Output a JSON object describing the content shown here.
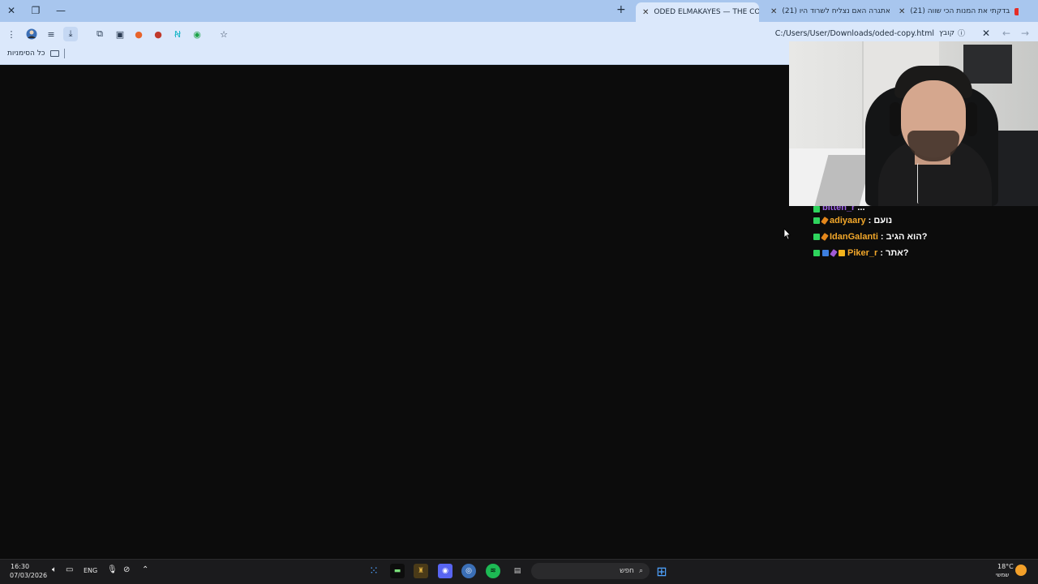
{
  "tabs": [
    {
      "title": "(21) בדקתי את המנות הכי שווה",
      "active": false
    },
    {
      "title": "(21) אתגרה האם נצליח לשרוד היו",
      "active": false
    },
    {
      "title": "ODED ELMAKAYES — THE COPY",
      "active": true
    }
  ],
  "address": {
    "url": "C:/Users/User/Downloads/oded-copy.html",
    "file_chip": "קובץ"
  },
  "bookmarks": {
    "all_bookmarks": "כל הסימניות"
  },
  "chat": {
    "partial_row": {
      "username": "bitten_r",
      "message": "..."
    },
    "rows": [
      {
        "username": "adiyaary",
        "message": ": נועם"
      },
      {
        "username": "IdanGalanti",
        "message": ": הוא הגיב?"
      },
      {
        "username": "Piker_r",
        "message": ": אתר?"
      }
    ]
  },
  "taskbar": {
    "time": "16:30",
    "date": "07/03/2026",
    "lang": "ENG",
    "search_placeholder": "חפש",
    "temperature": "18°C",
    "weather": "שמשי"
  },
  "colors": {
    "tabstrip": "#a8c6ee",
    "toolbar": "#dbe8fb",
    "page_bg": "#0c0c0c",
    "chat_username": "#f2a72a",
    "chat_message": "#ffffff"
  }
}
